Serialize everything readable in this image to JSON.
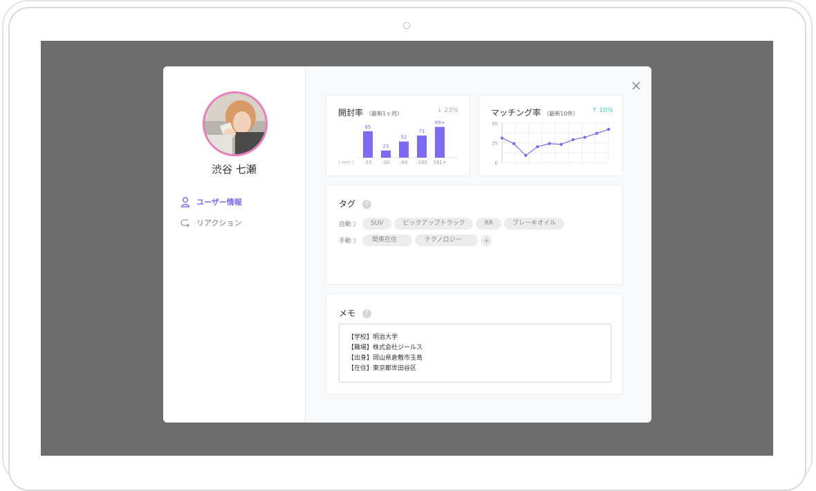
{
  "user": {
    "name": "渋谷 七瀬"
  },
  "nav": [
    {
      "label": "ユーザー情報",
      "icon": "user-icon",
      "active": true
    },
    {
      "label": "リアクション",
      "icon": "reaction-arrow-icon",
      "active": false
    }
  ],
  "open_rate": {
    "title": "開封率",
    "subtitle": "（最新1ヶ月）",
    "change": "↓ 23%",
    "unit_label": "( min )"
  },
  "match_rate": {
    "title": "マッチング率",
    "subtitle": "（最新10件）",
    "change": "↑ 10%"
  },
  "tags": {
    "title": "タグ",
    "auto_label": "自動 〉",
    "manual_label": "手動 〉",
    "auto": [
      "SUV",
      "ピックアップトラック",
      "RR",
      "ブレーキオイル"
    ],
    "manual": [
      "関東在住",
      "テクノロジー"
    ]
  },
  "memo": {
    "title": "メモ",
    "lines": [
      "【学校】明治大学",
      "【職場】株式会社ジールス",
      "【出身】岡山県倉敷市玉島",
      "【在住】東京都世田谷区"
    ]
  },
  "colors": {
    "accent": "#7b6cf0",
    "up": "#2fd1b8",
    "down": "#aaaaaa",
    "avatar_border": "#ea7cc0"
  },
  "chart_data": [
    {
      "type": "bar",
      "title": "開封率",
      "categories": [
        "-10",
        "-30",
        "-60",
        "-180",
        "181+"
      ],
      "values": [
        85,
        23,
        52,
        71,
        99
      ],
      "data_labels": [
        "85",
        "23",
        "52",
        "71",
        "99+"
      ],
      "ylim": [
        0,
        100
      ]
    },
    {
      "type": "line",
      "title": "マッチング率",
      "x": [
        1,
        2,
        3,
        4,
        5,
        6,
        7,
        8,
        9,
        10
      ],
      "values": [
        31,
        24,
        9,
        20,
        24,
        23,
        29,
        32,
        37,
        42
      ],
      "yticks": [
        "0",
        "25",
        "50"
      ],
      "ylim": [
        0,
        50
      ],
      "grid": true
    }
  ]
}
